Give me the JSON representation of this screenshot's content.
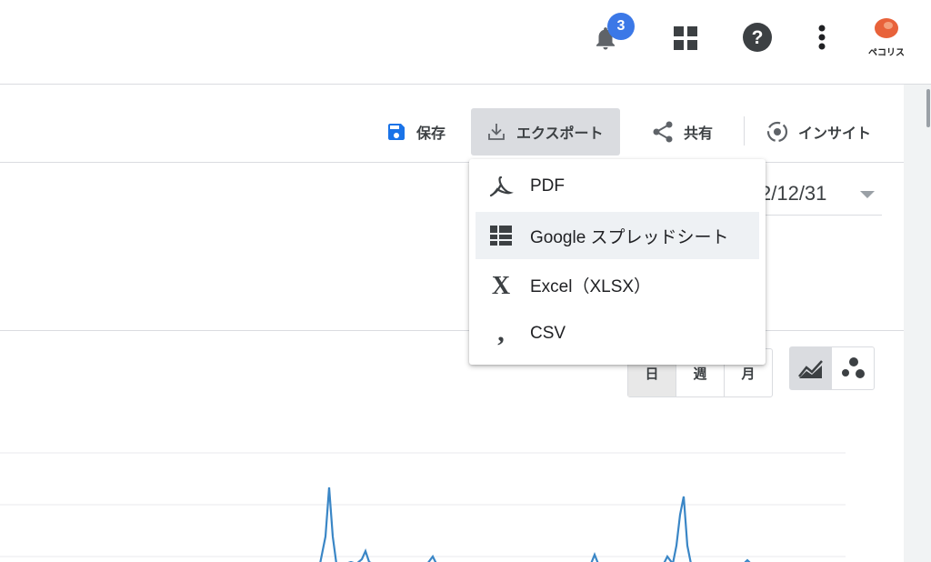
{
  "topbar": {
    "notification_count": "3",
    "logo_text": "ペコリス",
    "icons": [
      "bell-icon",
      "apps-grid-icon",
      "help-icon",
      "more-vert-icon",
      "pecoris-logo"
    ]
  },
  "toolbar": {
    "save_label": "保存",
    "export_label": "エクスポート",
    "share_label": "共有",
    "insight_label": "インサイト"
  },
  "date_range": {
    "end_fragment": "2/12/31"
  },
  "granularity": {
    "options": [
      "日",
      "週",
      "月"
    ],
    "selected": "日"
  },
  "export_menu": {
    "items": [
      {
        "label": "PDF",
        "icon": "pdf-icon"
      },
      {
        "label": "Google スプレッドシート",
        "icon": "google-sheets-icon"
      },
      {
        "label": "Excel（XLSX）",
        "icon": "excel-icon"
      },
      {
        "label": "CSV",
        "icon": "csv-comma-icon"
      }
    ],
    "highlighted_index": 1
  },
  "colors": {
    "accent_blue": "#1a73e8",
    "badge_blue": "#3b78e7",
    "line_blue": "#3a86c6",
    "logo_orange": "#e8623a"
  }
}
